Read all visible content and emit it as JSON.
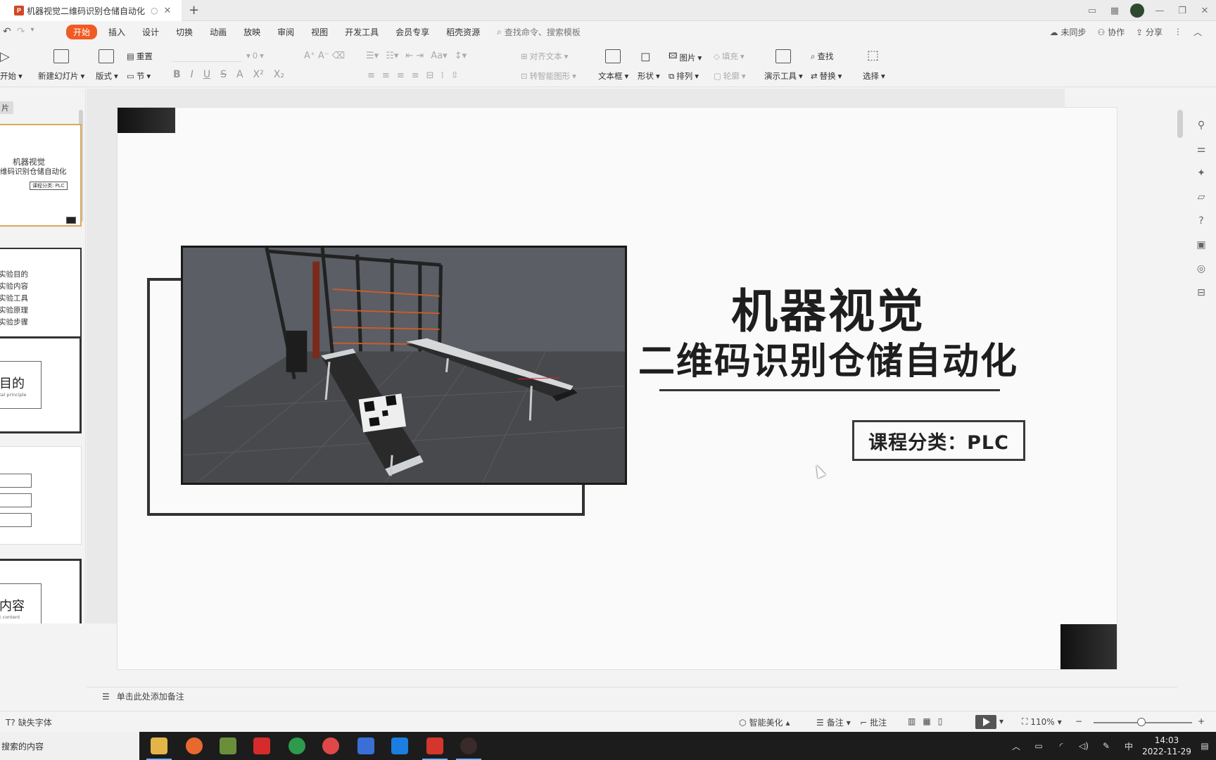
{
  "window": {
    "tab_title": "机器视觉二维码识别仓储自动化",
    "new_tab": "+"
  },
  "menu": {
    "items": [
      "开始",
      "插入",
      "设计",
      "切换",
      "动画",
      "放映",
      "审阅",
      "视图",
      "开发工具",
      "会员专享",
      "稻壳资源"
    ],
    "search": "查找命令、搜索模板",
    "sync": "未同步",
    "collab": "协作",
    "share": "分享"
  },
  "ribbon": {
    "start_slideshow": "开始",
    "new_slide": "新建幻灯片",
    "layout": "版式",
    "section": "节",
    "reset": "重置",
    "font_size": "0",
    "text_direction": "对齐文本",
    "smartart": "转智能图形",
    "textbox": "文本框",
    "shape": "形状",
    "picture": "图片",
    "arrange": "排列",
    "fill": "填充",
    "outline": "轮廓",
    "present_tools": "演示工具",
    "find": "查找",
    "replace": "替换",
    "select": "选择"
  },
  "slides_panel": {
    "tab_label": "片",
    "thumb1_title": "机器视觉",
    "thumb1_subtitle": "维码识别仓储自动化",
    "thumb1_badge": "课程分类: PLC",
    "thumb2_items": [
      "实验目的",
      "实验内容",
      "实验工具",
      "实验原理",
      "实验步骤"
    ],
    "thumb3_title": "目的",
    "thumb3_sub": "tal principle",
    "thumb5_title": "内容",
    "thumb5_sub": "t content"
  },
  "slide": {
    "title": "机器视觉",
    "subtitle": "二维码识别仓储自动化",
    "category": "课程分类：PLC"
  },
  "notes": {
    "placeholder": "单击此处添加备注"
  },
  "statusbar": {
    "missing_fonts": "缺失字体",
    "smart_beautify": "智能美化",
    "notes": "备注",
    "comments": "批注",
    "zoom": "110%"
  },
  "taskbar": {
    "search_text": "搜索的内容",
    "ime": "中",
    "time": "14:03",
    "date": "2022-11-29"
  },
  "colors": {
    "accent": "#f05a24",
    "thumb_selected": "#d9a860"
  }
}
